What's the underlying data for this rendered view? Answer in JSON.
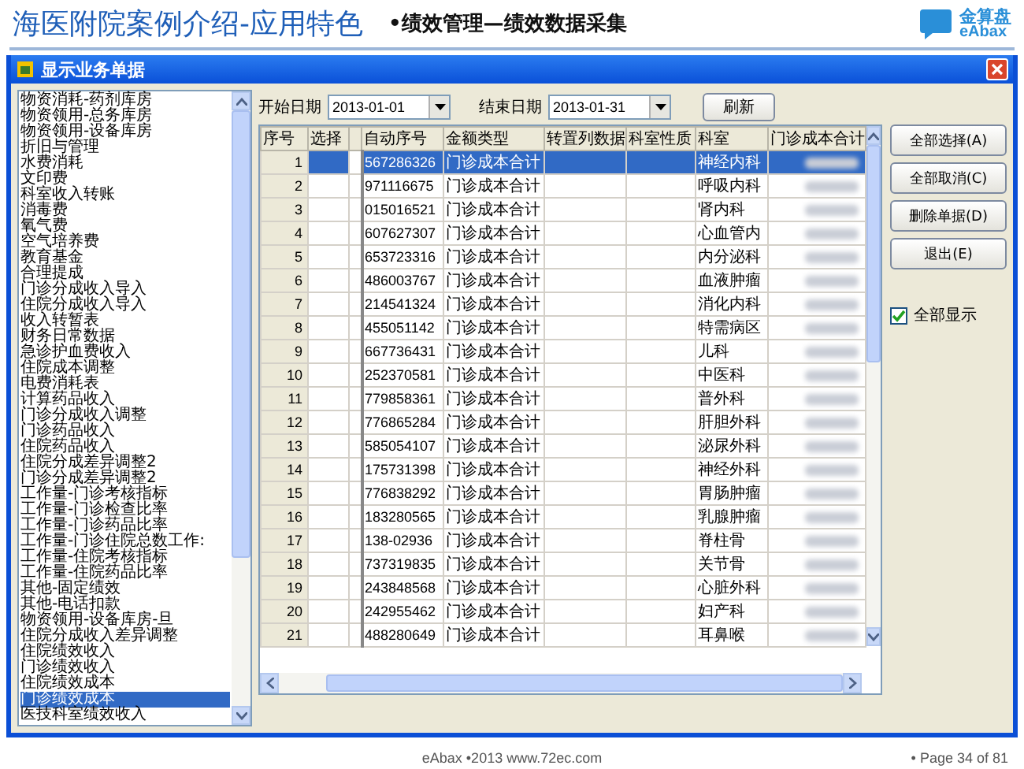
{
  "slide": {
    "title": "海医附院案例介绍-应用特色",
    "subtitle": "•绩效管理—绩效数据采集",
    "logo": {
      "name": "金算盘",
      "sub": "eAbax"
    }
  },
  "window": {
    "title": "显示业务单据"
  },
  "list": {
    "items": [
      {
        "label": "物资消耗-药剂库房",
        "selected": false
      },
      {
        "label": "物资领用-总务库房",
        "selected": false
      },
      {
        "label": "物资领用-设备库房",
        "selected": false
      },
      {
        "label": "折旧与管理",
        "selected": false
      },
      {
        "label": "水费消耗",
        "selected": false
      },
      {
        "label": "文印费",
        "selected": false
      },
      {
        "label": "科室收入转账",
        "selected": false
      },
      {
        "label": "消毒费",
        "selected": false
      },
      {
        "label": "氧气费",
        "selected": false
      },
      {
        "label": "空气培养费",
        "selected": false
      },
      {
        "label": "教育基金",
        "selected": false
      },
      {
        "label": "合理提成",
        "selected": false
      },
      {
        "label": "门诊分成收入导入",
        "selected": false
      },
      {
        "label": "住院分成收入导入",
        "selected": false
      },
      {
        "label": "收入转暂表",
        "selected": false
      },
      {
        "label": "财务日常数据",
        "selected": false
      },
      {
        "label": "急诊护血费收入",
        "selected": false
      },
      {
        "label": "住院成本调整",
        "selected": false
      },
      {
        "label": "电费消耗表",
        "selected": false
      },
      {
        "label": "计算药品收入",
        "selected": false
      },
      {
        "label": "门诊分成收入调整",
        "selected": false
      },
      {
        "label": "门诊药品收入",
        "selected": false
      },
      {
        "label": "住院药品收入",
        "selected": false
      },
      {
        "label": "住院分成差异调整2",
        "selected": false
      },
      {
        "label": "门诊分成差异调整2",
        "selected": false
      },
      {
        "label": "工作量-门诊考核指标",
        "selected": false
      },
      {
        "label": "工作量-门诊检查比率",
        "selected": false
      },
      {
        "label": "工作量-门诊药品比率",
        "selected": false
      },
      {
        "label": "工作量-门诊住院总数工作:",
        "selected": false
      },
      {
        "label": "工作量-住院考核指标",
        "selected": false
      },
      {
        "label": "工作量-住院药品比率",
        "selected": false
      },
      {
        "label": "其他-固定绩效",
        "selected": false
      },
      {
        "label": "其他-电话扣款",
        "selected": false
      },
      {
        "label": "物资领用-设备库房-旦",
        "selected": false
      },
      {
        "label": "住院分成收入差异调整",
        "selected": false
      },
      {
        "label": "住院绩效收入",
        "selected": false
      },
      {
        "label": "门诊绩效收入",
        "selected": false
      },
      {
        "label": "住院绩效成本",
        "selected": false
      },
      {
        "label": "门诊绩效成本",
        "selected": true
      },
      {
        "label": "医技科室绩效收入",
        "selected": false
      }
    ]
  },
  "filters": {
    "start_label": "开始日期",
    "start_value": "2013-01-01",
    "end_label": "结束日期",
    "end_value": "2013-01-31",
    "refresh": "刷新"
  },
  "table": {
    "columns": [
      {
        "label": "序号",
        "kind": "num"
      },
      {
        "label": "选择",
        "kind": "blank"
      },
      {
        "kind": "stub"
      },
      {
        "label": "自动序号",
        "kind": "id"
      },
      {
        "label": "金额类型",
        "kind": "type"
      },
      {
        "label": "转置列数据",
        "kind": "blank"
      },
      {
        "label": "科室性质",
        "kind": "blank"
      },
      {
        "label": "科室",
        "kind": "dept"
      },
      {
        "label": "门诊成本合计",
        "kind": "blurred"
      }
    ],
    "rows": [
      {
        "number": "1",
        "auto_no": "567286326",
        "amount_type": "门诊成本合计",
        "department": "神经内科",
        "selected": true
      },
      {
        "number": "2",
        "auto_no": "971116675",
        "amount_type": "门诊成本合计",
        "department": "呼吸内科",
        "selected": false
      },
      {
        "number": "3",
        "auto_no": "015016521",
        "amount_type": "门诊成本合计",
        "department": "肾内科",
        "selected": false
      },
      {
        "number": "4",
        "auto_no": "607627307",
        "amount_type": "门诊成本合计",
        "department": "心血管内",
        "selected": false
      },
      {
        "number": "5",
        "auto_no": "653723316",
        "amount_type": "门诊成本合计",
        "department": "内分泌科",
        "selected": false
      },
      {
        "number": "6",
        "auto_no": "486003767",
        "amount_type": "门诊成本合计",
        "department": "血液肿瘤",
        "selected": false
      },
      {
        "number": "7",
        "auto_no": "214541324",
        "amount_type": "门诊成本合计",
        "department": "消化内科",
        "selected": false
      },
      {
        "number": "8",
        "auto_no": "455051142",
        "amount_type": "门诊成本合计",
        "department": "特需病区",
        "selected": false
      },
      {
        "number": "9",
        "auto_no": "667736431",
        "amount_type": "门诊成本合计",
        "department": "儿科",
        "selected": false
      },
      {
        "number": "10",
        "auto_no": "252370581",
        "amount_type": "门诊成本合计",
        "department": "中医科",
        "selected": false
      },
      {
        "number": "11",
        "auto_no": "779858361",
        "amount_type": "门诊成本合计",
        "department": "普外科",
        "selected": false
      },
      {
        "number": "12",
        "auto_no": "776865284",
        "amount_type": "门诊成本合计",
        "department": "肝胆外科",
        "selected": false
      },
      {
        "number": "13",
        "auto_no": "585054107",
        "amount_type": "门诊成本合计",
        "department": "泌尿外科",
        "selected": false
      },
      {
        "number": "14",
        "auto_no": "175731398",
        "amount_type": "门诊成本合计",
        "department": "神经外科",
        "selected": false
      },
      {
        "number": "15",
        "auto_no": "776838292",
        "amount_type": "门诊成本合计",
        "department": "胃肠肿瘤",
        "selected": false
      },
      {
        "number": "16",
        "auto_no": "183280565",
        "amount_type": "门诊成本合计",
        "department": "乳腺肿瘤",
        "selected": false
      },
      {
        "number": "17",
        "auto_no": "138-02936",
        "amount_type": "门诊成本合计",
        "department": "脊柱骨",
        "selected": false
      },
      {
        "number": "18",
        "auto_no": "737319835",
        "amount_type": "门诊成本合计",
        "department": "关节骨",
        "selected": false
      },
      {
        "number": "19",
        "auto_no": "243848568",
        "amount_type": "门诊成本合计",
        "department": "心脏外科",
        "selected": false
      },
      {
        "number": "20",
        "auto_no": "242955462",
        "amount_type": "门诊成本合计",
        "department": "妇产科",
        "selected": false
      },
      {
        "number": "21",
        "auto_no": "488280649",
        "amount_type": "门诊成本合计",
        "department": "耳鼻喉",
        "selected": false
      }
    ]
  },
  "buttons": [
    "全部选择(A)",
    "全部取消(C)",
    "删除单据(D)",
    "退出(E)"
  ],
  "show_all": {
    "label": "全部显示",
    "checked": true
  },
  "footer": {
    "center": "eAbax •2013 www.72ec.com",
    "page": "• Page 34 of 81"
  }
}
